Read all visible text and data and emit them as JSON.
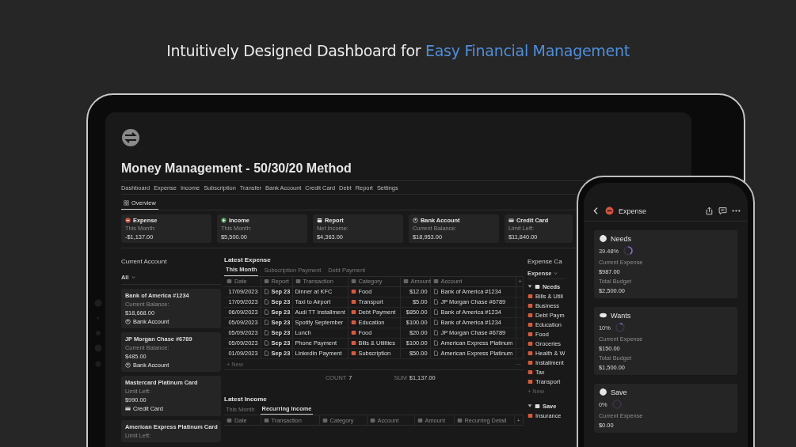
{
  "headline": {
    "text": "Intuitively Designed Dashboard for",
    "highlight": "Easy Financial Management"
  },
  "tablet": {
    "title": "Money Management - 50/30/20 Method",
    "nav": [
      "Dashboard",
      "Expense",
      "Income",
      "Subscription",
      "Transfer",
      "Bank Account",
      "Credit Card",
      "Debt",
      "Report",
      "Settings"
    ],
    "view_tab": {
      "label": "Overview",
      "selected": true
    },
    "summary_cards": [
      {
        "kind": "expense",
        "title": "Expense",
        "label": "This Month:",
        "value": "-$1,137.00"
      },
      {
        "kind": "income",
        "title": "Income",
        "label": "This Month:",
        "value": "$5,500.00"
      },
      {
        "kind": "report",
        "title": "Report",
        "label": "Net Income:",
        "value": "$4,363.00"
      },
      {
        "kind": "bank",
        "title": "Bank Account",
        "label": "Current Balance:",
        "value": "$18,953.00"
      },
      {
        "kind": "card",
        "title": "Credit Card",
        "label": "Limit Left:",
        "value": "$11,840.00"
      }
    ],
    "current_account": {
      "title": "Current Account",
      "filter": "All",
      "cards": [
        {
          "name": "Bank of America #1234",
          "label": "Current Balance:",
          "value": "$18,668.00",
          "type": "Bank Account",
          "kind": "bank"
        },
        {
          "name": "JP Morgan Chase #6789",
          "label": "Current Balance:",
          "value": "$485.00",
          "type": "Bank Account",
          "kind": "bank"
        },
        {
          "name": "Mastercard Platinum Card",
          "label": "Limit Left:",
          "value": "$990.00",
          "type": "Credit Card",
          "kind": "card"
        },
        {
          "name": "American Express Platinum Card",
          "label": "Limit Left:"
        }
      ]
    },
    "latest_expense": {
      "title": "Latest Expense",
      "tabs": [
        {
          "label": "This Month",
          "selected": true
        },
        {
          "label": "Subscription Payment",
          "selected": false
        },
        {
          "label": "Debt Payment",
          "selected": false
        }
      ],
      "columns": [
        "Date",
        "Report",
        "Transaction",
        "Category",
        "Amount",
        "Account"
      ],
      "rows": [
        [
          "17/09/2023",
          "Sep 23",
          "Dinner at KFC",
          "Food",
          "$12.00",
          "Bank of America #1234"
        ],
        [
          "17/09/2023",
          "Sep 23",
          "Taxi to Airport",
          "Transport",
          "$5.00",
          "JP Morgan Chase #6789"
        ],
        [
          "06/09/2023",
          "Sep 23",
          "Audi TT Installment",
          "Debt Payment",
          "$850.00",
          "Bank of America #1234"
        ],
        [
          "05/09/2023",
          "Sep 23",
          "Spotify September",
          "Education",
          "$100.00",
          "Bank of America #1234"
        ],
        [
          "05/09/2023",
          "Sep 23",
          "Lunch",
          "Food",
          "$20.00",
          "JP Morgan Chase #6789"
        ],
        [
          "05/09/2023",
          "Sep 23",
          "Phone Payment",
          "Bills & Utilities",
          "$100.00",
          "American Express Platinum"
        ],
        [
          "01/09/2023",
          "Sep 23",
          "LinkedIn Payment",
          "Subscription",
          "$50.00",
          "American Express Platinum"
        ]
      ],
      "add_column": "+",
      "more": "···",
      "new_row": "+ New",
      "count_label": "COUNT",
      "count": "7",
      "sum_label": "SUM",
      "sum": "$1,137.00"
    },
    "latest_income": {
      "title": "Latest Income",
      "tabs": [
        {
          "label": "This Month",
          "selected": false
        },
        {
          "label": "Recurring Income",
          "selected": true
        }
      ],
      "columns": [
        "Date",
        "Transaction",
        "Category",
        "Account",
        "Amount",
        "Recurring Detail"
      ],
      "add_column": "+"
    },
    "expense_categories": {
      "title": "Expense Ca",
      "view": "Expense",
      "groups": [
        {
          "name": "Needs",
          "expanded": true,
          "items": [
            "Bills & Utili",
            "Business",
            "Debt Paym",
            "Education",
            "Food",
            "Groceries",
            "Health & W",
            "Installment",
            "Tax",
            "Transport"
          ],
          "new_row": "+ New"
        },
        {
          "name": "Save",
          "expanded": true,
          "items": [
            "Insurance"
          ]
        }
      ]
    }
  },
  "phone": {
    "title": "Expense",
    "budgets": [
      {
        "name": "Needs",
        "percent": "39.48%",
        "level": 0.3948,
        "expense_label": "Current Expense",
        "expense": "$987.00",
        "budget_label": "Total Budget",
        "budget": "$2,500.00"
      },
      {
        "name": "Wants",
        "percent": "10%",
        "level": 0.1,
        "expense_label": "Current Expense",
        "expense": "$150.00",
        "budget_label": "Total Budget",
        "budget": "$1,500.00"
      },
      {
        "name": "Save",
        "percent": "0%",
        "level": 0,
        "expense_label": "Current Expense",
        "expense": "$0.00"
      }
    ]
  }
}
